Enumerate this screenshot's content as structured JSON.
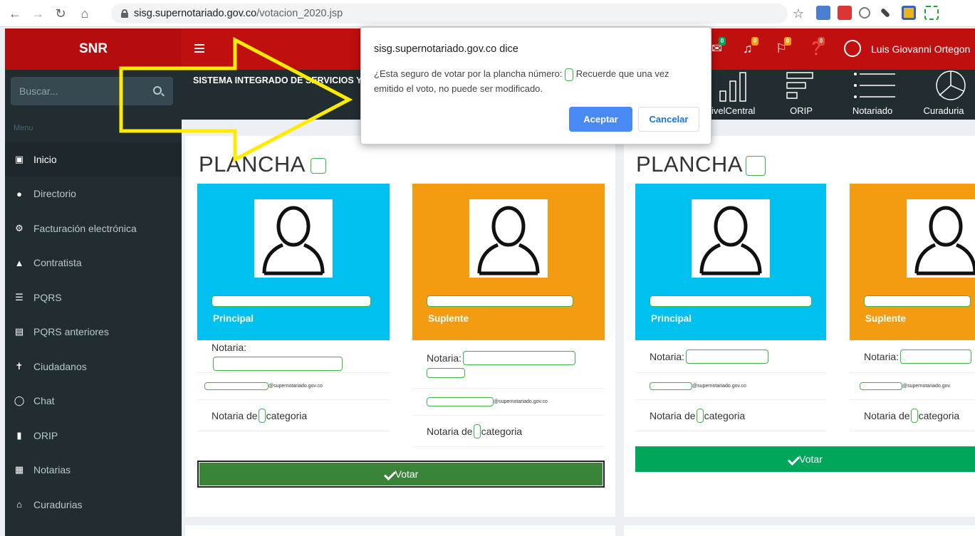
{
  "browser": {
    "url_host": "sisg.supernotariado.gov.co",
    "url_path": "/votacion_2020.jsp"
  },
  "header": {
    "brand": "SNR",
    "user_name": "Luis Giovanni Ortegon",
    "badges": [
      "0",
      "0",
      "0",
      "0"
    ],
    "badge_colors": [
      "#00a65a",
      "#f39c12",
      "#f39c12",
      "#dd4b39"
    ]
  },
  "sidebar": {
    "search_placeholder": "Buscar...",
    "menu_header": "Menu",
    "items": [
      {
        "label": "Inicio",
        "icon": "laptop-icon"
      },
      {
        "label": "Directorio",
        "icon": "users-icon"
      },
      {
        "label": "Facturación electrónica",
        "icon": "gears-icon"
      },
      {
        "label": "Contratista",
        "icon": "user-icon"
      },
      {
        "label": "PQRS",
        "icon": "list-icon"
      },
      {
        "label": "PQRS anteriores",
        "icon": "card-icon"
      },
      {
        "label": "Ciudadanos",
        "icon": "person-icon"
      },
      {
        "label": "Chat",
        "icon": "chat-icon"
      },
      {
        "label": "ORIP",
        "icon": "book-icon"
      },
      {
        "label": "Notarias",
        "icon": "bank-icon"
      },
      {
        "label": "Curadurias",
        "icon": "home-icon"
      }
    ]
  },
  "content_header": {
    "system_title": "SISTEMA INTEGRADO DE SERVICIOS Y",
    "quick_links": [
      "ivelCentral",
      "ORIP",
      "Notariado",
      "Curaduria"
    ]
  },
  "planchas": [
    {
      "title": "PLANCHA",
      "principal": {
        "role": "Principal",
        "notaria_label": "Notaria:",
        "email_suffix": "@supernotariado.gov.co",
        "category_prefix": "Notaria de",
        "category_suffix": "categoria"
      },
      "suplente": {
        "role": "Suplente",
        "notaria_label": "Notaria:",
        "email_suffix": "@supernotariado.gov.co",
        "category_prefix": "Notaria de",
        "category_suffix": "categoria"
      },
      "vote_label": "Votar"
    },
    {
      "title": "PLANCHA",
      "principal": {
        "role": "Principal",
        "notaria_label": "Notaria:",
        "email_suffix": "@supernotariado.gov.co",
        "category_prefix": "Notaria de",
        "category_suffix": "categoria"
      },
      "suplente": {
        "role": "Suplente",
        "notaria_label": "Notaria:",
        "email_suffix": "@supernotariado.gov.",
        "category_prefix": "Notaria de",
        "category_suffix": "categoria"
      },
      "vote_label": "Votar"
    }
  ],
  "dialog": {
    "title": "sisg.supernotariado.gov.co dice",
    "message_part1": "¿Esta seguro de votar por la plancha número:",
    "message_part2": "Recuerde que una vez emitido el voto, no puede ser modificado.",
    "ok_label": "Aceptar",
    "cancel_label": "Cancelar"
  },
  "colors": {
    "header_red": "#c00f0f",
    "sidebar": "#222d32",
    "principal": "#00c0ef",
    "suplente": "#f39c12",
    "vote": "#00a65a",
    "annotation_arrow": "#ffeb00"
  }
}
